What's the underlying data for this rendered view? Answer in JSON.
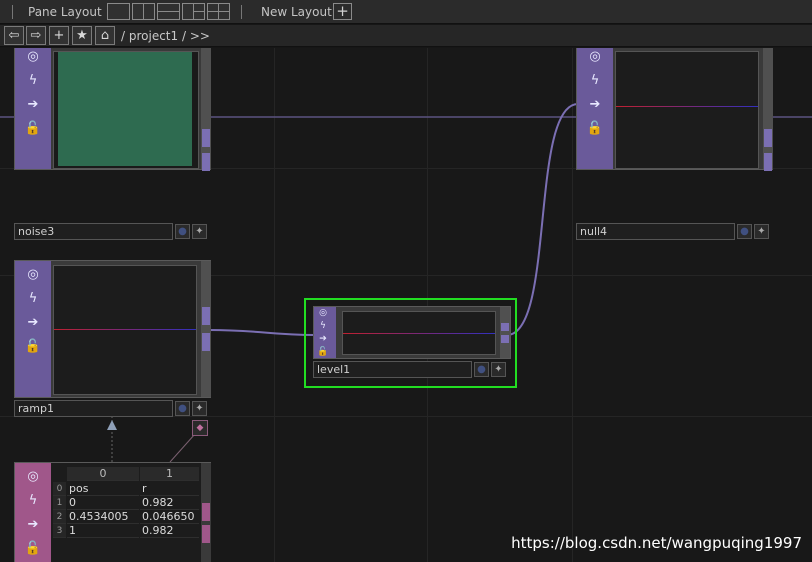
{
  "topbar": {
    "pane_layout_label": "Pane Layout",
    "new_layout_label": "New Layout",
    "add_symbol": "+"
  },
  "pathbar": {
    "back_symbol": "⇦",
    "forward_symbol": "⇨",
    "add_symbol": "+",
    "star_symbol": "★",
    "home_symbol": "⌂",
    "path": "/ project1 / >>"
  },
  "nodes": {
    "noise3": {
      "label": "noise3"
    },
    "null4": {
      "label": "null4"
    },
    "ramp1": {
      "label": "ramp1"
    },
    "level1": {
      "label": "level1"
    }
  },
  "table": {
    "col_headers": [
      "0",
      "1"
    ],
    "row_indices": [
      "0",
      "1",
      "2",
      "3"
    ],
    "rows": [
      [
        "pos",
        "r"
      ],
      [
        "0",
        "0.982"
      ],
      [
        "0.4534005",
        "0.046650"
      ],
      [
        "1",
        "0.982"
      ]
    ]
  },
  "icons": {
    "strip": [
      "viewer-icon",
      "bypass-icon",
      "export-icon",
      "lock-icon"
    ],
    "flag_dot": "●",
    "flag_plus": "✦",
    "pin": "◆"
  },
  "colors": {
    "operator_strip": "#6a5a9a",
    "dat_strip": "#a0578a",
    "selection": "#22dd22",
    "wire": "#7b6fb3",
    "noise_preview": "#2e6b50"
  },
  "watermark": "https://blog.csdn.net/wangpuqing1997"
}
